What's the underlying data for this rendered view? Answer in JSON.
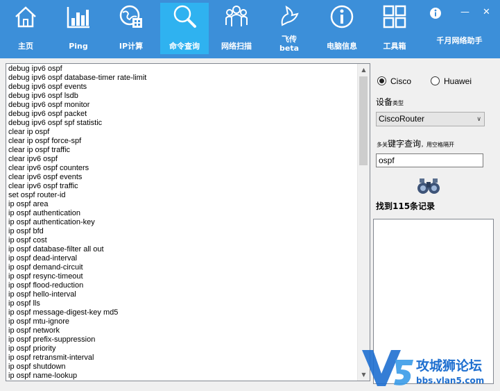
{
  "toolbar": {
    "items": [
      {
        "label": "主页",
        "icon": "home-icon"
      },
      {
        "label": "Ping",
        "icon": "bar-chart-icon"
      },
      {
        "label": "IP计算",
        "icon": "globe-calc-icon"
      },
      {
        "label": "命令查询",
        "icon": "search-icon",
        "active": true
      },
      {
        "label": "网络扫描",
        "icon": "users-icon"
      },
      {
        "label": "飞传",
        "label2": "beta",
        "icon": "dove-icon"
      },
      {
        "label": "电脑信息",
        "icon": "info-icon"
      },
      {
        "label": "工具箱",
        "icon": "grid-icon"
      }
    ],
    "brand": "千月网络助手",
    "accent": "#3c8fd9",
    "active_color": "#2fb2f0"
  },
  "commands": [
    "debug ipv6 ospf",
    "debug ipv6 ospf database-timer rate-limit",
    "debug ipv6 ospf events",
    "debug ipv6 ospf lsdb",
    "debug ipv6 ospf monitor",
    "debug ipv6 ospf packet",
    "debug ipv6 ospf spf statistic",
    "clear ip ospf",
    "clear ip ospf force-spf",
    "clear ip ospf traffic",
    "clear ipv6 ospf",
    "clear ipv6 ospf counters",
    "clear ipv6 ospf events",
    "clear ipv6 ospf traffic",
    "set ospf router-id",
    "ip ospf area",
    "ip ospf authentication",
    "ip ospf authentication-key",
    "ip ospf bfd",
    "ip ospf cost",
    "ip ospf database-filter all out",
    "ip ospf dead-interval",
    "ip ospf demand-circuit",
    "ip ospf resync-timeout",
    "ip ospf flood-reduction",
    "ip ospf hello-interval",
    "ip ospf lls",
    "ip ospf message-digest-key md5",
    "ip ospf mtu-ignore",
    "ip ospf network",
    "ip ospf prefix-suppression",
    "ip ospf priority",
    "ip ospf retransmit-interval",
    "ip ospf shutdown",
    "ip ospf name-lookup"
  ],
  "panel": {
    "radio_cisco": "Cisco",
    "radio_huawei": "Huawei",
    "device_type_label": "设备",
    "device_type_small": "类型",
    "device_select_value": "CiscoRouter",
    "hint_small1": "多关",
    "hint_big": "键字查询",
    "hint_small2": "，用空格隔开",
    "search_value": "ospf",
    "found_text": "找到115条记录"
  },
  "watermark": {
    "title": "攻城狮论坛",
    "url": "bbs.vlan5.com"
  }
}
